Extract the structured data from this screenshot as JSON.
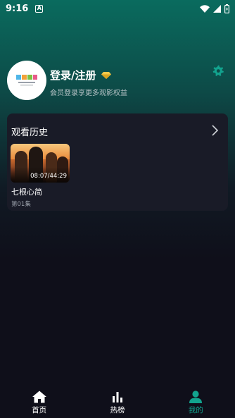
{
  "status_bar": {
    "time": "9:16",
    "notification_badge": "A",
    "icons": [
      "wifi-icon",
      "signal-icon",
      "battery-charging-icon"
    ]
  },
  "profile": {
    "avatar_icon": "app-logo-icon",
    "login_label": "登录/注册",
    "vip_icon": "diamond-icon",
    "subtitle": "会员登录享更多观影权益",
    "settings_icon": "gear-icon"
  },
  "history": {
    "title": "观看历史",
    "more_icon": "chevron-right-icon",
    "items": [
      {
        "title": "七根心简",
        "progress": "08:07/44:29",
        "episode": "第01集"
      }
    ]
  },
  "bottom_nav": {
    "items": [
      {
        "label": "首页",
        "icon": "home-icon",
        "active": false
      },
      {
        "label": "热榜",
        "icon": "bar-chart-icon",
        "active": false
      },
      {
        "label": "我的",
        "icon": "user-icon",
        "active": true
      }
    ],
    "active_color": "#12a38e"
  },
  "colors": {
    "accent": "#12a38e",
    "gem": "#f2c94c",
    "background": "#0f0f1a",
    "card": "#191b27"
  }
}
